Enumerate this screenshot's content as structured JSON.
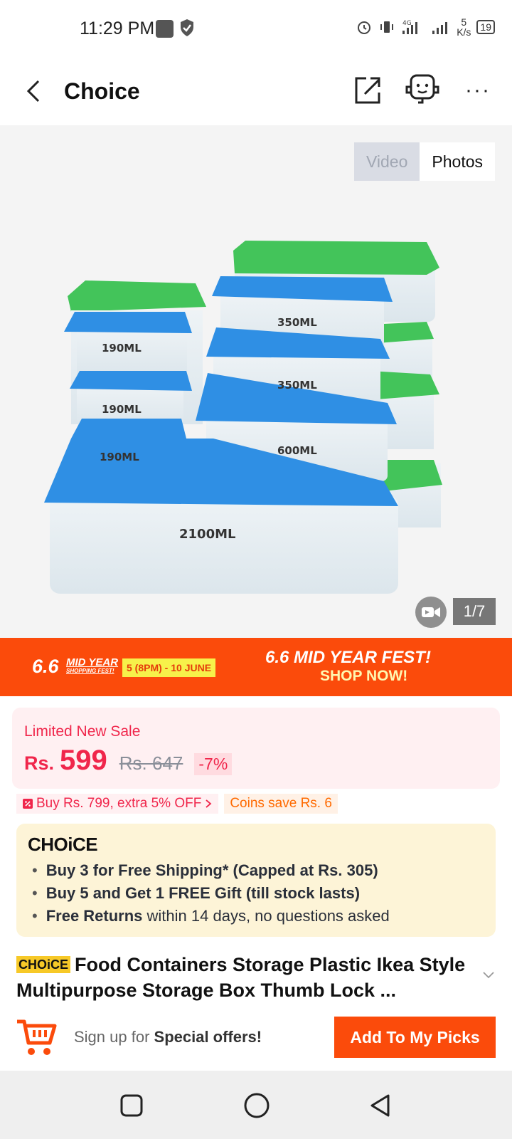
{
  "status_bar": {
    "time": "11:29 PM",
    "speed_value": "5",
    "speed_unit": "K/s",
    "battery": "19"
  },
  "header": {
    "title": "Choice"
  },
  "gallery": {
    "tabs": {
      "video": "Video",
      "photos": "Photos"
    },
    "counter": "1/7",
    "image_labels": [
      "350ML",
      "190ML",
      "350ML",
      "190ML",
      "600ML",
      "190ML",
      "2100ML"
    ]
  },
  "banner": {
    "logo_number": "6.6",
    "logo_title": "MID YEAR",
    "logo_subtitle": "SHOPPING FEST!",
    "dates": "5 (8PM) - 10 JUNE",
    "headline": "6.6 MID YEAR FEST!",
    "cta": "SHOP NOW!"
  },
  "price": {
    "label": "Limited New Sale",
    "currency": "Rs.",
    "current": "599",
    "original": "Rs. 647",
    "discount": "-7%"
  },
  "promos": {
    "buy_more": "Buy Rs. 799, extra 5% OFF",
    "coins": "Coins save Rs. 6"
  },
  "choice": {
    "logo": "CHOiCE",
    "benefit1": "Buy 3 for  Free Shipping* (Capped at Rs. 305)",
    "benefit2": "Buy 5 and Get 1 FREE Gift (till stock lasts)",
    "benefit3_bold": "Free Returns",
    "benefit3_rest": " within 14 days, no questions asked"
  },
  "product": {
    "badge": "CHOiCE",
    "title": "Food Containers Storage Plastic Ikea Style Multipurpose Storage Box Thumb Lock ..."
  },
  "bottom_bar": {
    "signup_prefix": "Sign up for ",
    "signup_bold": "Special offers!",
    "picks_button": "Add To My Picks"
  },
  "colors": {
    "accent": "#fb4b0b",
    "price": "#f0264b",
    "choice_bg": "#fdf4d7"
  }
}
